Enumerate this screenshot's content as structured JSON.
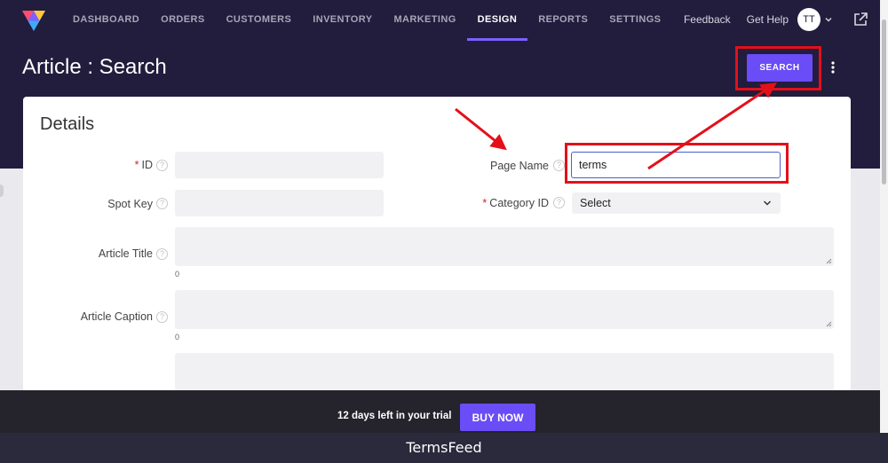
{
  "nav": {
    "items": [
      {
        "label": "DASHBOARD",
        "active": false
      },
      {
        "label": "ORDERS",
        "active": false
      },
      {
        "label": "CUSTOMERS",
        "active": false
      },
      {
        "label": "INVENTORY",
        "active": false
      },
      {
        "label": "MARKETING",
        "active": false
      },
      {
        "label": "DESIGN",
        "active": true
      },
      {
        "label": "REPORTS",
        "active": false
      },
      {
        "label": "SETTINGS",
        "active": false
      }
    ],
    "feedback": "Feedback",
    "help": "Get Help",
    "avatar_initials": "TT"
  },
  "page": {
    "title": "Article : Search",
    "search_button": "SEARCH"
  },
  "details": {
    "title": "Details",
    "id_label": "ID",
    "spot_key_label": "Spot Key",
    "page_name_label": "Page Name",
    "page_name_value": "terms",
    "category_label": "Category ID",
    "category_value": "Select",
    "article_title_label": "Article Title",
    "article_title_count": "0",
    "article_caption_label": "Article Caption",
    "article_caption_count": "0"
  },
  "trial": {
    "text": "12 days left in your trial",
    "buy_button": "BUY NOW"
  },
  "footer": {
    "text": "TermsFeed"
  },
  "colors": {
    "header_bg": "#221c3d",
    "accent": "#6a4df6",
    "highlight": "#e3101a"
  },
  "icons": [
    "logo-icon",
    "chevron-down-icon",
    "external-link-icon",
    "kebab-menu-icon",
    "help-icon",
    "resize-handle-icon"
  ]
}
